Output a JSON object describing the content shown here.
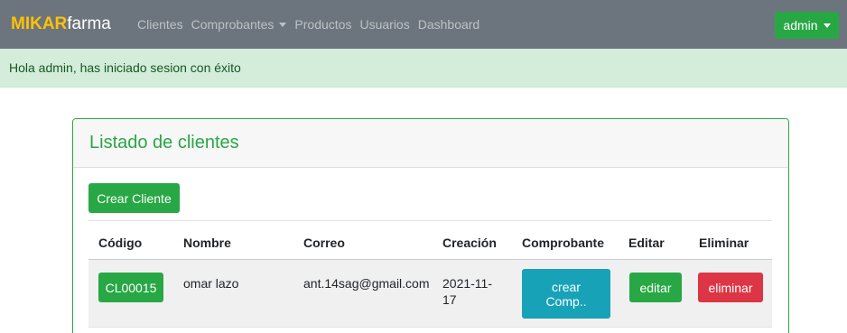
{
  "navbar": {
    "brand_bold": "MIKAR",
    "brand_rest": "farma",
    "links": [
      "Clientes",
      "Comprobantes",
      "Productos",
      "Usuarios",
      "Dashboard"
    ],
    "user_label": "admin"
  },
  "alert": {
    "message": "Hola admin, has iniciado sesion con éxito"
  },
  "card": {
    "title": "Listado de clientes",
    "create_button": "Crear Cliente",
    "columns": [
      "Código",
      "Nombre",
      "Correo",
      "Creación",
      "Comprobante",
      "Editar",
      "Eliminar"
    ],
    "rows": [
      {
        "codigo": "CL00015",
        "nombre": "omar lazo",
        "correo": "ant.14sag@gmail.com",
        "creacion_line1": "2021-11-",
        "creacion_line2": "17",
        "comprobante_line1": "crear",
        "comprobante_line2": "Comp..",
        "editar": "editar",
        "eliminar": "eliminar"
      }
    ]
  },
  "colors": {
    "navbar_bg": "#6c757d",
    "brand_accent": "#ffc107",
    "success": "#28a745",
    "info": "#17a2b8",
    "danger": "#dc3545",
    "alert_bg": "#d4edda"
  },
  "icons": [
    "caret-down-icon"
  ]
}
